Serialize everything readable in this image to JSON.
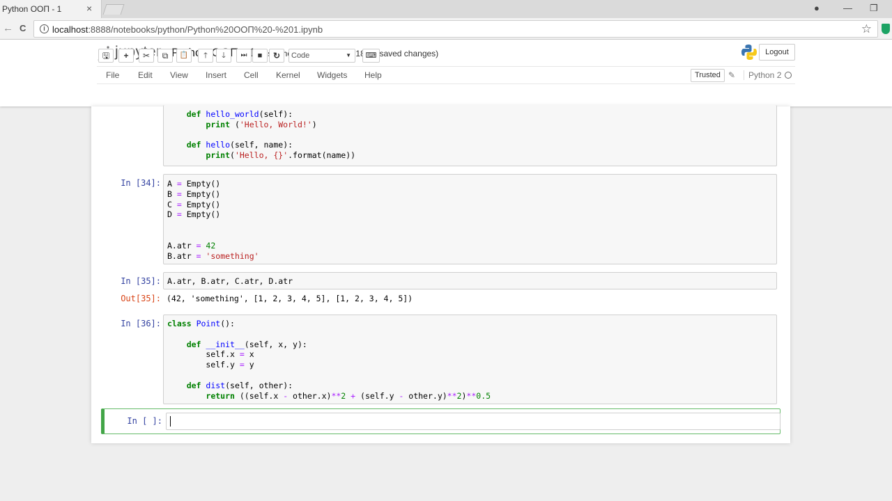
{
  "browser": {
    "tab_title": "Python ООП - 1",
    "tab_close": "×",
    "url_host": "localhost",
    "url_rest": ":8888/notebooks/python/Python%20ООП%20-%201.ipynb",
    "back": "←",
    "forward": "→",
    "reload": "C",
    "bookmark": "☆",
    "minimize": "—",
    "restore": "❐",
    "close": "✕",
    "account": "●"
  },
  "jupyter": {
    "logo": "jupyter",
    "notebook_name": "Python ООП - 1",
    "checkpoint": "Last Checkpoint: 02/10/2018 (unsaved changes)",
    "logout": "Logout",
    "menu": [
      "File",
      "Edit",
      "View",
      "Insert",
      "Cell",
      "Kernel",
      "Widgets",
      "Help"
    ],
    "trusted": "Trusted",
    "kernel": "Python 2",
    "cell_type": "Code",
    "toolbar": {
      "save": "🖫",
      "add": "+",
      "cut": "✂",
      "copy": "⧉",
      "paste": "📋",
      "up": "🡑",
      "down": "🡓",
      "run": "⏭",
      "stop": "■",
      "restart": "↻",
      "keyboard": "⌨"
    }
  },
  "cells": {
    "c1_code": "    def hello_world(self):\n        print ('Hello, World!')\n\n    def hello(self, name):\n        print('Hello, {}'.format(name))",
    "c2_prompt": "In [34]:",
    "c3_prompt": "In [35]:",
    "c3_code": "A.atr, B.atr, C.atr, D.atr",
    "c3_out_prompt": "Out[35]:",
    "c3_out": "(42, 'something', [1, 2, 3, 4, 5], [1, 2, 3, 4, 5])",
    "c4_prompt": "In [36]:",
    "c5_prompt": "In [ ]:"
  },
  "colors": {
    "accent_selected": "#42a547",
    "prompt_in": "#303f9f",
    "prompt_out": "#d84315"
  }
}
